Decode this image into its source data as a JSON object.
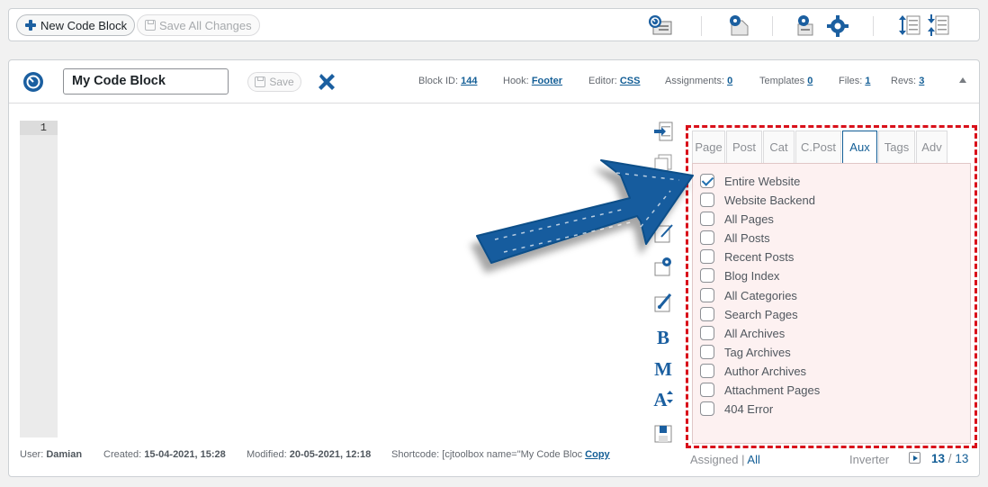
{
  "colors": {
    "accent": "#1b5fa0",
    "highlight_border": "#d9101a",
    "link": "#135e96"
  },
  "toolbar": {
    "new_block_label": "New Code Block",
    "save_all_label": "Save All Changes",
    "icons": [
      "settings-panel-icon",
      "plugin-gear-icon",
      "gear-pair-icon",
      "expand-all-icon",
      "collapse-all-icon"
    ]
  },
  "block": {
    "name": "My Code Block",
    "save_label": "Save",
    "meta": [
      {
        "label": "Block ID:",
        "value": "144"
      },
      {
        "label": "Hook:",
        "value": "Footer"
      },
      {
        "label": "Editor:",
        "value": "CSS"
      },
      {
        "label": "Assignments:",
        "value": "0"
      },
      {
        "label": "Templates",
        "value": "0"
      },
      {
        "label": "Files:",
        "value": "1"
      },
      {
        "label": "Revs:",
        "value": "3"
      }
    ]
  },
  "editor": {
    "line_number": "1"
  },
  "side_tools": [
    "import-icon",
    "copy-icon",
    "edit-icon",
    "gear-doc-icon",
    "brush-icon",
    "bold-icon",
    "minify-icon",
    "font-size-icon",
    "save-icon"
  ],
  "side_glyphs": {
    "bold": "B",
    "minify": "M",
    "font": "A"
  },
  "footer": {
    "user_label": "User:",
    "user": "Damian",
    "created_label": "Created:",
    "created": "15-04-2021, 15:28",
    "modified_label": "Modified:",
    "modified": "20-05-2021, 12:18",
    "shortcode_label": "Shortcode:",
    "shortcode": "[cjtoolbox name=\"My Code Bloc",
    "copy_label": "Copy"
  },
  "assignments": {
    "tabs": [
      "Page",
      "Post",
      "Cat",
      "C.Post",
      "Aux",
      "Tags",
      "Adv"
    ],
    "active_tab": "Aux",
    "items": [
      {
        "label": "Entire Website",
        "checked": true
      },
      {
        "label": "Website Backend",
        "checked": false
      },
      {
        "label": "All Pages",
        "checked": false
      },
      {
        "label": "All Posts",
        "checked": false
      },
      {
        "label": "Recent Posts",
        "checked": false
      },
      {
        "label": "Blog Index",
        "checked": false
      },
      {
        "label": "All Categories",
        "checked": false
      },
      {
        "label": "Search Pages",
        "checked": false
      },
      {
        "label": "All Archives",
        "checked": false
      },
      {
        "label": "Tag Archives",
        "checked": false
      },
      {
        "label": "Author Archives",
        "checked": false
      },
      {
        "label": "Attachment Pages",
        "checked": false
      },
      {
        "label": "404 Error",
        "checked": false
      }
    ],
    "footer": {
      "assigned": "Assigned",
      "separator": "|",
      "all": "All",
      "inverter": "Inverter",
      "page_current": "13",
      "page_sep": "/",
      "page_total": "13"
    }
  }
}
